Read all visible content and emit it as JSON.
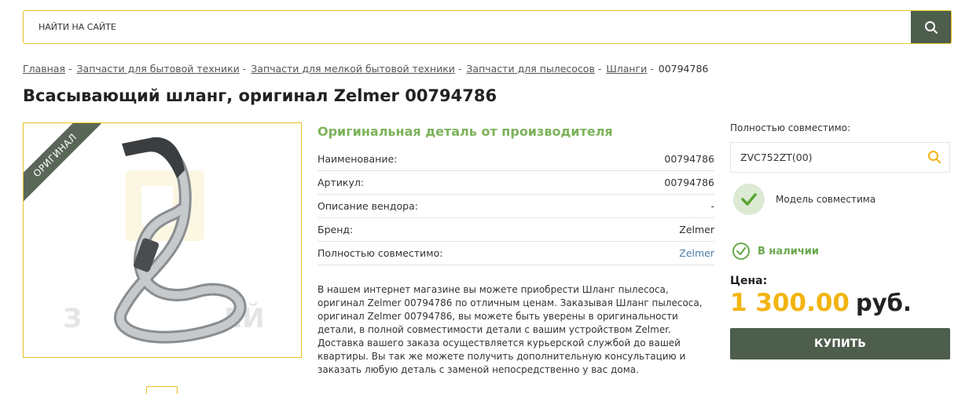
{
  "search": {
    "placeholder": "НАЙТИ НА САЙТЕ"
  },
  "breadcrumb": {
    "items": [
      "Главная",
      "Запчасти для бытовой техники",
      "Запчасти для мелкой бытовой техники",
      "Запчасти для пылесосов",
      "Шланги"
    ],
    "current": "00794786",
    "separator": "-"
  },
  "product": {
    "title": "Всасывающий шланг, оригинал Zelmer 00794786",
    "ribbon": "ОРИГИНАЛ",
    "details_heading": "Оригинальная деталь от производителя",
    "specs": [
      {
        "label": "Наименование:",
        "value": "00794786"
      },
      {
        "label": "Артикул:",
        "value": "00794786"
      },
      {
        "label": "Описание вендора:",
        "value": "-"
      },
      {
        "label": "Бренд:",
        "value": "Zelmer"
      },
      {
        "label": "Полностью совместимо:",
        "value": "Zelmer"
      }
    ],
    "description": "В нашем интернет магазине вы можете приобрести Шланг пылесоса, оригинал Zelmer 00794786 по отличным ценам. Заказывая Шланг пылесоса, оригинал Zelmer 00794786, вы можете быть уверены в оригинальности детали, в полной совместимости детали с вашим устройством Zelmer. Доставка вашего заказа осуществляется курьерской службой до вашей квартиры. Вы так же можете получить дополнительную консультацию и заказать любую деталь с заменой непосредственно у вас дома."
  },
  "compat": {
    "label": "Полностью совместимо:",
    "input_value": "ZVC752ZT(00)",
    "status": "Модель совместима"
  },
  "purchase": {
    "stock": "В наличии",
    "price_label": "Цена:",
    "price": "1 300.00",
    "currency": "руб.",
    "buy_label": "КУПИТЬ"
  },
  "colors": {
    "accent_yellow": "#e8c322",
    "button_dark_green": "#4d5e4c",
    "stock_green": "#6aa84f",
    "price_orange": "#f2b40f"
  },
  "icons": {
    "search": "search-icon",
    "compat_search": "search-icon",
    "compat_check": "check-icon",
    "stock_check": "check-circle-icon"
  }
}
